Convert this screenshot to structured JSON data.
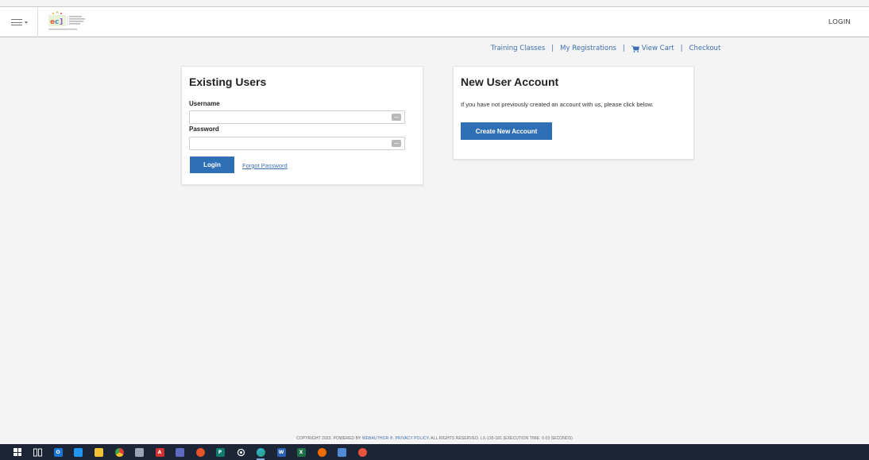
{
  "header": {
    "login_label": "LOGIN",
    "menu_icon": "hamburger-menu-icon",
    "logo_icon": "organization-logo"
  },
  "sub_nav": {
    "items": [
      "Training Classes",
      "My Registrations",
      "View Cart",
      "Checkout"
    ],
    "separator": "|",
    "cart_icon": "cart-icon"
  },
  "existing_users": {
    "title": "Existing Users",
    "username_label": "Username",
    "username_value": "",
    "password_label": "Password",
    "password_value": "",
    "login_button": "Login",
    "forgot_password": "Forgot Password"
  },
  "new_user": {
    "title": "New User Account",
    "description": "If you have not previously created an account with us, please click below.",
    "create_button": "Create New Account"
  },
  "footer": {
    "text_before": "COPYRIGHT 2023. POWERED BY ",
    "link_webauthor": "WEBAUTHOR ®",
    "dot": ". ",
    "link_privacy": "PRIVACY POLICY",
    "text_after": ". ALL RIGHTS RESERVED. LX-135-181 (EXECUTION TIME: 0.03 SECONDS)"
  },
  "taskbar": {
    "icons": [
      "windows-start-icon",
      "task-view-icon",
      "outlook-icon",
      "calendar-icon",
      "file-explorer-icon",
      "chrome-icon",
      "camera-icon",
      "acrobat-icon",
      "teams-icon",
      "powerpoint-icon",
      "publisher-icon",
      "settings-icon",
      "edge-icon",
      "word-icon",
      "excel-icon",
      "opera-icon",
      "snipping-tool-icon",
      "snagit-icon"
    ],
    "word_letter": "W",
    "excel_letter": "X",
    "powerpoint_letter": "P",
    "publisher_letter": "P",
    "acrobat_letter": "A"
  },
  "colors": {
    "accent": "#2f6fb5",
    "link": "#3b6fb0",
    "taskbar": "#1c2535"
  }
}
